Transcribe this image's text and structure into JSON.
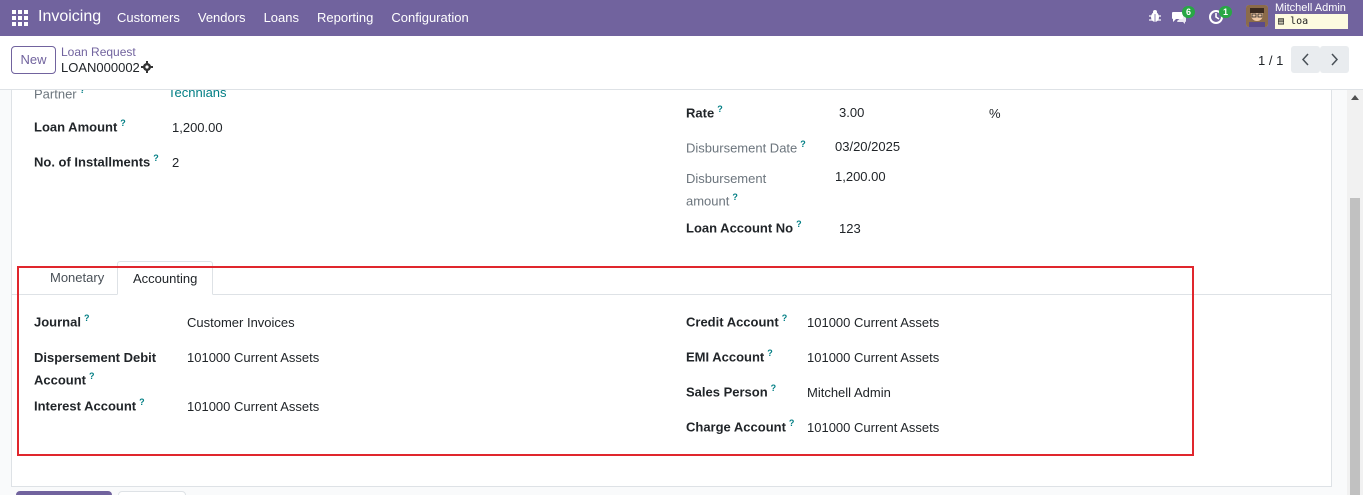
{
  "navbar": {
    "brand": "Invoicing",
    "menu": [
      "Customers",
      "Vendors",
      "Loans",
      "Reporting",
      "Configuration"
    ],
    "chat_count": "6",
    "activity_count": "1",
    "user_name": "Mitchell Admin",
    "db_name": "loa"
  },
  "control": {
    "new_label": "New",
    "breadcrumb": "Loan Request",
    "record_name": "LOAN000002",
    "pager": "1 / 1"
  },
  "form": {
    "partner_label": "Partner",
    "partner_value": "Technians",
    "loan_amount_label": "Loan Amount",
    "loan_amount_value": "1,200.00",
    "installments_label": "No. of Installments",
    "installments_value": "2",
    "rate_label": "Rate",
    "rate_value": "3.00",
    "rate_unit": "%",
    "disb_date_label": "Disbursement Date",
    "disb_date_value": "03/20/2025",
    "disb_amount_label_1": "Disbursement",
    "disb_amount_label_2": "amount",
    "disb_amount_value": "1,200.00",
    "loan_account_label": "Loan Account No",
    "loan_account_value": "123"
  },
  "tabs": [
    "Monetary",
    "Accounting"
  ],
  "accounting": {
    "journal_label": "Journal",
    "journal_value": "Customer Invoices",
    "debit_label_1": "Dispersement Debit",
    "debit_label_2": "Account",
    "debit_value": "101000 Current Assets",
    "interest_label": "Interest Account",
    "interest_value": "101000 Current Assets",
    "credit_label": "Credit Account",
    "credit_value": "101000 Current Assets",
    "emi_label": "EMI Account",
    "emi_value": "101000 Current Assets",
    "sales_label": "Sales Person",
    "sales_value": "Mitchell Admin",
    "charge_label": "Charge Account",
    "charge_value": "101000 Current Assets"
  },
  "help_mark": "?"
}
